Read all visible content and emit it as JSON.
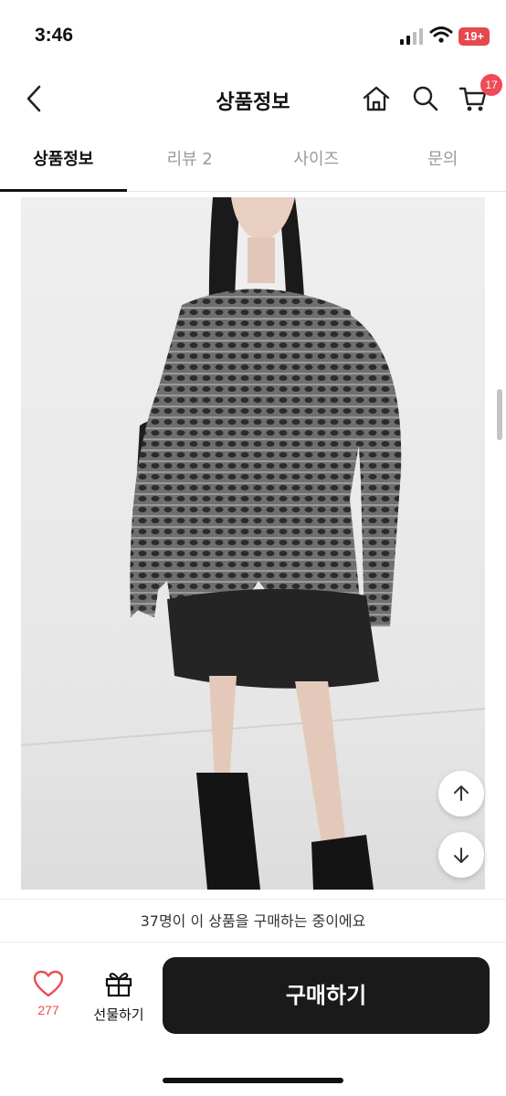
{
  "status_bar": {
    "time": "3:46",
    "battery": "19+"
  },
  "header": {
    "title": "상품정보",
    "cart_count": "17"
  },
  "tabs": [
    {
      "label": "상품정보",
      "active": true
    },
    {
      "label": "리뷰 2",
      "active": false
    },
    {
      "label": "사이즈",
      "active": false
    },
    {
      "label": "문의",
      "active": false
    }
  ],
  "icons": {
    "back": "chevron-left-icon",
    "home": "home-icon",
    "search": "search-icon",
    "cart": "cart-icon",
    "scroll_up": "arrow-up-icon",
    "scroll_down": "arrow-down-icon",
    "like": "heart-icon",
    "gift": "gift-icon"
  },
  "bottom": {
    "viewers_text": "37명이 이 상품을 구매하는 중이에요",
    "like_count": "277",
    "gift_label": "선물하기",
    "buy_label": "구매하기"
  },
  "colors": {
    "accent": "#ef4a57",
    "buy_button": "#1a1a1a",
    "battery": "#e5484d"
  }
}
